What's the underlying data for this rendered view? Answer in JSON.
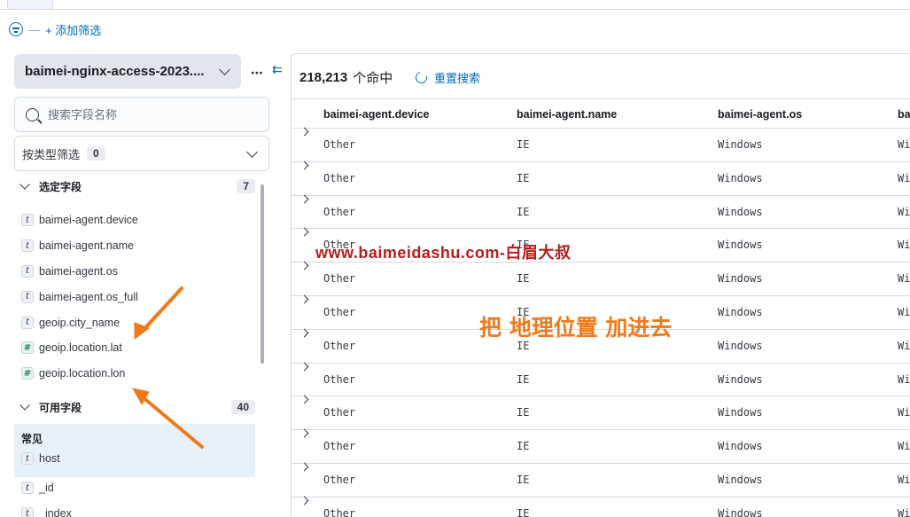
{
  "filter_bar": {
    "separator": "—",
    "add_filter": "+ 添加筛选"
  },
  "sidebar": {
    "index_pattern": "baimei-nginx-access-2023....",
    "menu_glyph": "⋯",
    "collapse_glyph": "⇇",
    "search_placeholder": "搜索字段名称",
    "type_filter_label": "按类型筛选",
    "type_filter_count": "0",
    "selected": {
      "title": "选定字段",
      "count": "7",
      "fields": [
        {
          "type": "t",
          "name": "baimei-agent.device"
        },
        {
          "type": "t",
          "name": "baimei-agent.name"
        },
        {
          "type": "t",
          "name": "baimei-agent.os"
        },
        {
          "type": "t",
          "name": "baimei-agent.os_full"
        },
        {
          "type": "t",
          "name": "geoip.city_name"
        },
        {
          "type": "#",
          "name": "geoip.location.lat"
        },
        {
          "type": "#",
          "name": "geoip.location.lon"
        }
      ]
    },
    "available": {
      "title": "可用字段",
      "count": "40",
      "common_title": "常见",
      "common_fields": [
        {
          "type": "t",
          "name": "host"
        }
      ],
      "fields": [
        {
          "type": "t",
          "name": "_id"
        },
        {
          "type": "t",
          "name": "_index"
        }
      ]
    }
  },
  "main": {
    "hits_count": "218,213",
    "hits_label": "个命中",
    "reset_label": "重置搜索",
    "columns": [
      "baimei-agent.device",
      "baimei-agent.name",
      "baimei-agent.os",
      "ba"
    ],
    "rows": [
      [
        "Other",
        "IE",
        "Windows",
        "Wi"
      ],
      [
        "Other",
        "IE",
        "Windows",
        "Wi"
      ],
      [
        "Other",
        "IE",
        "Windows",
        "Wi"
      ],
      [
        "Other",
        "IE",
        "Windows",
        "Wi"
      ],
      [
        "Other",
        "IE",
        "Windows",
        "Wi"
      ],
      [
        "Other",
        "IE",
        "Windows",
        "Wi"
      ],
      [
        "Other",
        "IE",
        "Windows",
        "Wi"
      ],
      [
        "Other",
        "IE",
        "Windows",
        "Wi"
      ],
      [
        "Other",
        "IE",
        "Windows",
        "Wi"
      ],
      [
        "Other",
        "IE",
        "Windows",
        "Wi"
      ],
      [
        "Other",
        "IE",
        "Windows",
        "Wi"
      ],
      [
        "Other",
        "IE",
        "Windows",
        "Wi"
      ]
    ]
  },
  "overlay": {
    "watermark": "www.baimeidashu.com-白眉大叔",
    "annotation": "把 地理位置 加进去",
    "arrow_color": "#f07a1a"
  }
}
